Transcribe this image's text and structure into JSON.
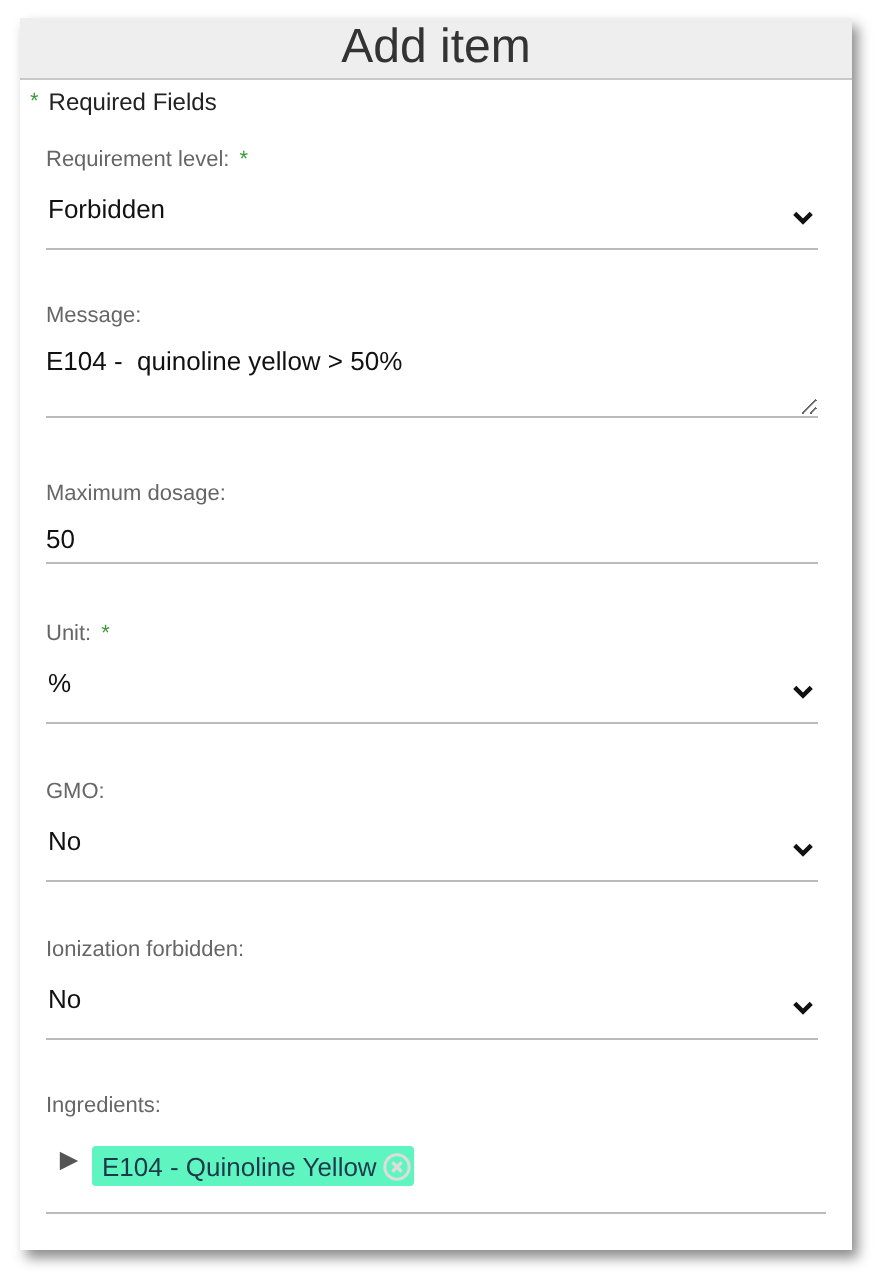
{
  "dialog": {
    "title": "Add item",
    "required_note": {
      "mark": "*",
      "text": "Required Fields"
    }
  },
  "fields": [
    {
      "kind": "select",
      "label": "Requirement level:",
      "required": true,
      "value": "Forbidden"
    },
    {
      "kind": "textarea",
      "label": "Message:",
      "required": false,
      "value": "E104 -  quinoline yellow > 50%"
    },
    {
      "kind": "input",
      "label": "Maximum dosage:",
      "required": false,
      "value": "50"
    },
    {
      "kind": "select",
      "label": "Unit:",
      "required": true,
      "value": "%"
    },
    {
      "kind": "select",
      "label": "GMO:",
      "required": false,
      "value": "No"
    },
    {
      "kind": "select",
      "label": "Ionization forbidden:",
      "required": false,
      "value": "No"
    },
    {
      "kind": "tags",
      "label": "Ingredients:",
      "required": false,
      "expanded": false,
      "tags": [
        {
          "label": "E104 - Quinoline Yellow",
          "color": "#5ef5c0"
        }
      ]
    }
  ]
}
